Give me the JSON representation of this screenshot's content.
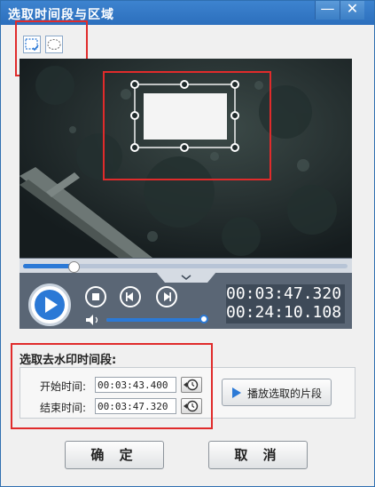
{
  "window": {
    "title": "选取时间段与区域",
    "minimize_glyph": "—",
    "close_glyph": "✕"
  },
  "tools": [
    {
      "name": "rect-select-tool",
      "icon": "dashed-rectangle-check-icon",
      "active": true
    },
    {
      "name": "ellipse-select-tool",
      "icon": "dashed-ellipse-icon",
      "active": false
    }
  ],
  "player": {
    "progress_fraction": 0.153,
    "volume_fraction": 1.0,
    "current_time": "00:03:47.320",
    "total_time": "00:24:10.108",
    "colors": {
      "accent": "#2b79d6",
      "bar": "#5a6675"
    }
  },
  "watermark_section": {
    "label": "选取去水印时间段:",
    "start_label": "开始时间:",
    "start_value": "00:03:43.400",
    "end_label": "结束时间:",
    "end_value": "00:03:47.320",
    "play_selection_label": "播放选取的片段"
  },
  "buttons": {
    "ok": "确 定",
    "cancel": "取 消"
  },
  "annotation_color": "#e02b2b"
}
